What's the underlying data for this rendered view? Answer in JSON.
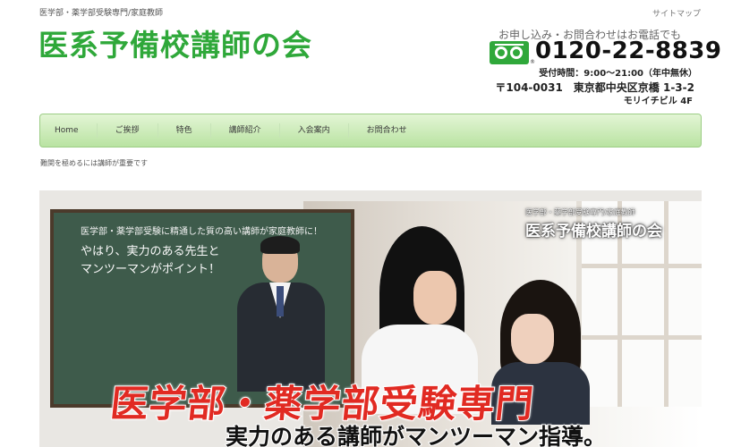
{
  "header": {
    "tagline": "医学部・薬学部受験専門/家庭教師",
    "sitemap_label": "サイトマップ",
    "site_title": "医系予備校講師の会"
  },
  "contact": {
    "lead": "お申し込み・お問合わせはお電話でも",
    "freedial_icon": "freedial-icon",
    "reg_mark": "®",
    "phone": "0120-22-8839",
    "hours": "受付時間：9:00〜21:00（年中無休）",
    "address_line1": "〒104-0031　東京都中央区京橋 1-3-2",
    "address_line2": "モリイチビル 4F"
  },
  "nav": {
    "items": [
      "Home",
      "ご挨拶",
      "特色",
      "講師紹介",
      "入会案内",
      "お問合わせ"
    ]
  },
  "subtitle": "難関を極めるには講師が重要です",
  "hero": {
    "board_line1": "医学部・薬学部受験に精通した質の高い講師が家庭教師に！",
    "board_line2": "やはり、実力のある先生と",
    "board_line3": "マンツーマンがポイント！",
    "brand_small": "医学部・薬学部受験専門/家庭教師",
    "brand": "医系予備校講師の会",
    "headline": "医学部・薬学部受験専門",
    "subheadline": "実力のある講師がマンツーマン指導。"
  },
  "colors": {
    "brand_green": "#2fa83a",
    "headline_red": "#e12a22",
    "nav_gradient_top": "#e3f5d5",
    "nav_gradient_bottom": "#b9e3a2"
  }
}
